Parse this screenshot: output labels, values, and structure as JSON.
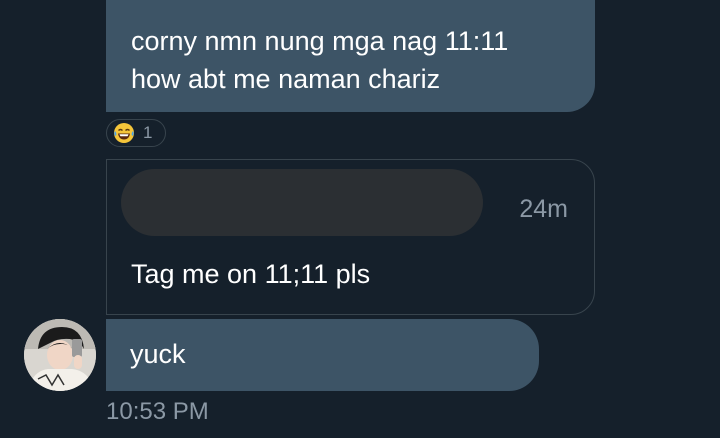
{
  "colors": {
    "background": "#15202b",
    "bubble": "#3d5466",
    "border": "#38444d",
    "muted_text": "#8b98a5",
    "text": "#ffffff"
  },
  "messages": [
    {
      "lines": [
        "corny nmn nung mga nag 11:11",
        "how abt me naman chariz"
      ],
      "reaction": {
        "emoji": "face-with-tears-of-joy-icon",
        "count": "1"
      }
    }
  ],
  "quoted_card": {
    "time": "24m",
    "text": "Tag me on 11;11 pls"
  },
  "reply": {
    "avatar": "user-avatar",
    "text": "yuck",
    "timestamp": "10:53 PM"
  }
}
